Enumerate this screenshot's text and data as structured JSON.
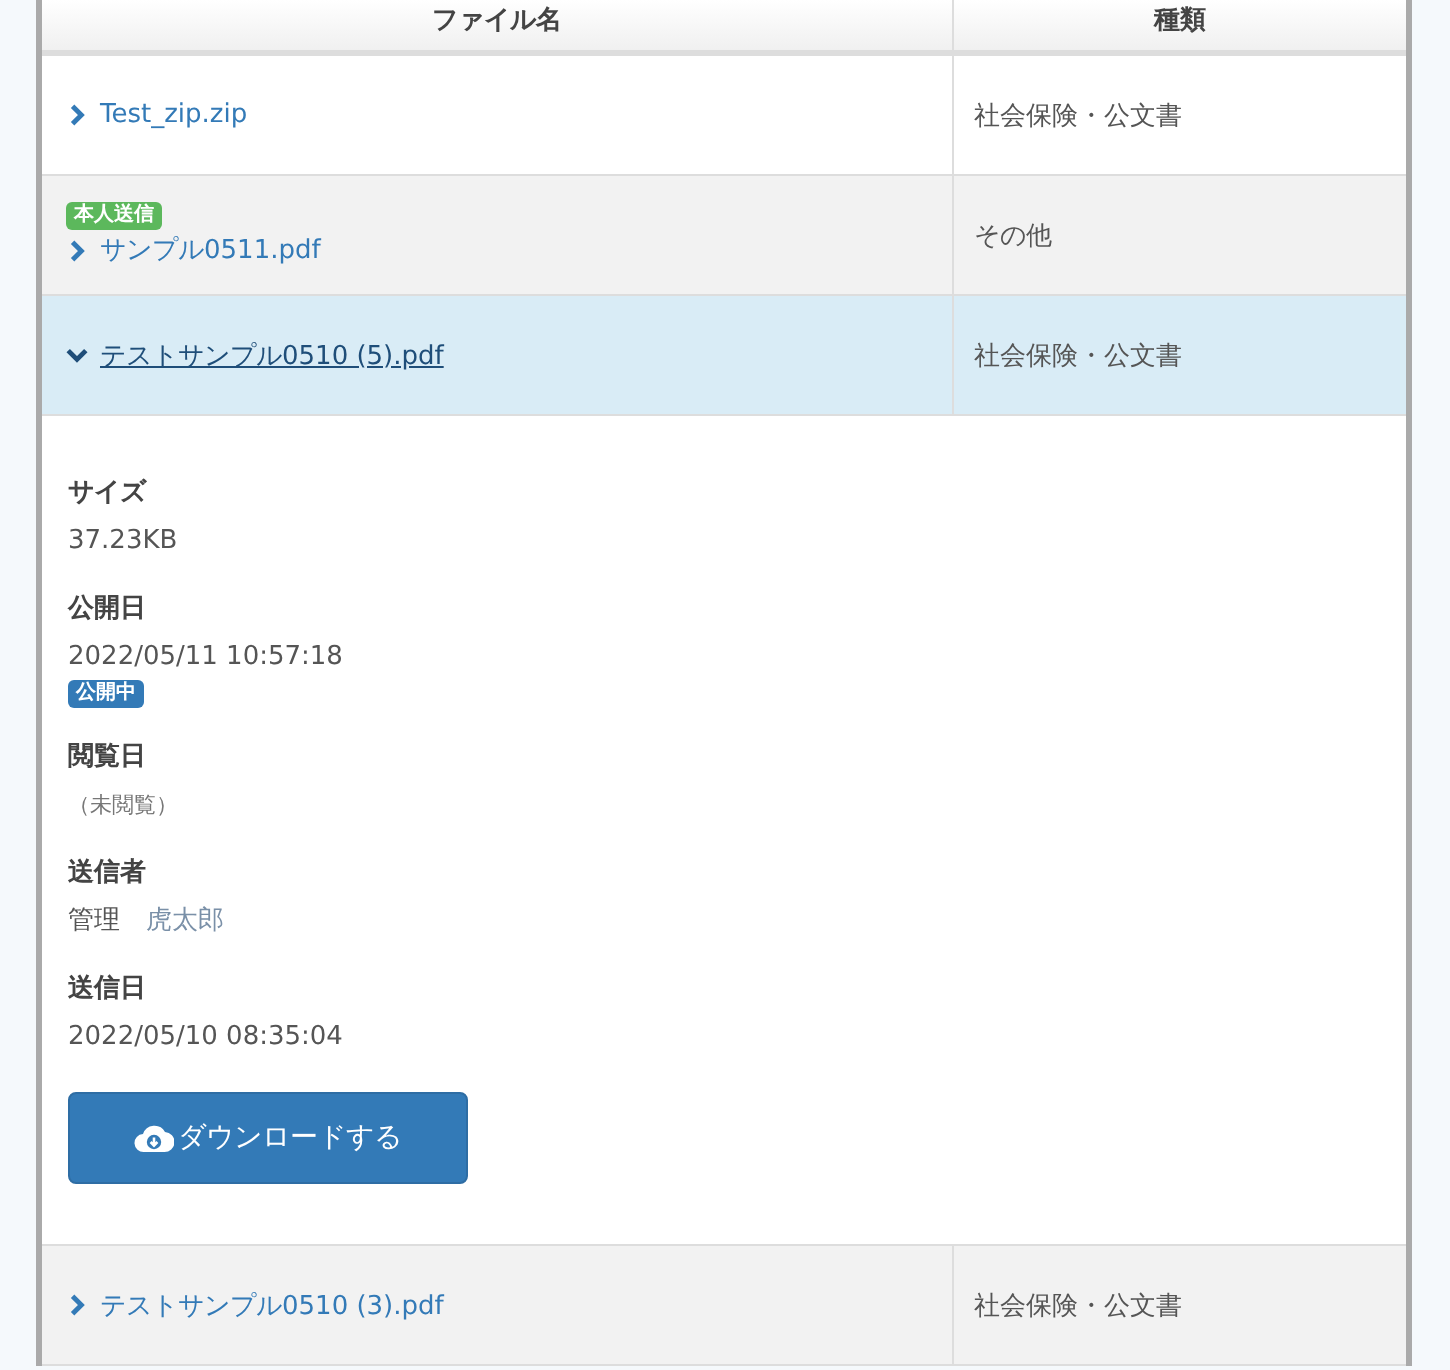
{
  "table": {
    "columns": [
      "ファイル名",
      "種類"
    ],
    "rows": [
      {
        "name": "Test_zip.zip",
        "category": "社会保険・公文書",
        "expanded": false
      },
      {
        "name": "サンプル0511.pdf",
        "category": "その他",
        "expanded": false,
        "badge": "本人送信"
      },
      {
        "name": " テストサンプル0510 (5).pdf",
        "category": "社会保険・公文書",
        "expanded": true,
        "details": [
          {
            "label": "サイズ",
            "value": "37.23KB"
          },
          {
            "label": "公開日",
            "value": "2022/05/11 10:57:18",
            "badge": "公開中"
          },
          {
            "label": "閲覧日",
            "value": "（未閲覧）",
            "muted": true
          },
          {
            "label": "送信者",
            "value": "管理",
            "value_2": "虎太郎"
          },
          {
            "label": "送信日",
            "value": "2022/05/10 08:35:04"
          }
        ],
        "button": "ダウンロードする"
      },
      {
        "name": "テストサンプル0510 (3).pdf",
        "category": "社会保険・公文書",
        "expanded": false
      }
    ]
  }
}
